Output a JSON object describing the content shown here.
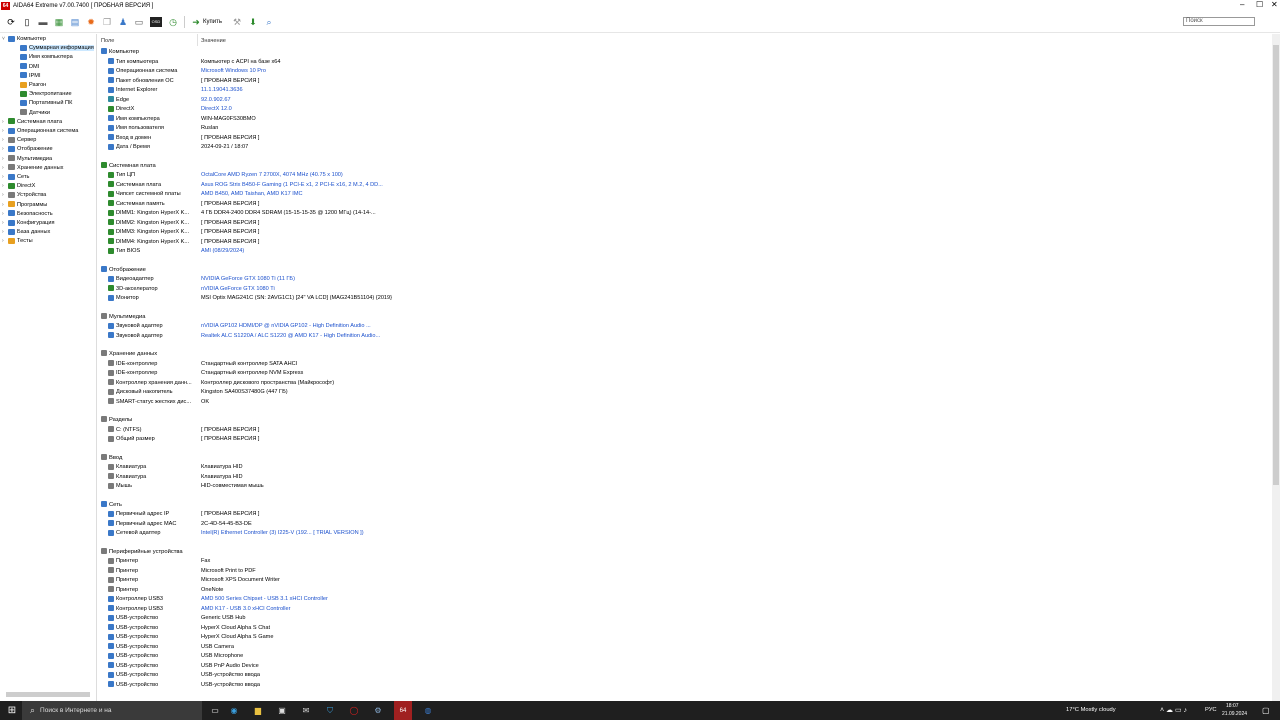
{
  "window": {
    "logo": "64",
    "title": "AIDA64 Extreme v7.00.7400  [ ПРОБНАЯ ВЕРСИЯ ]",
    "controls": {
      "min": "‒",
      "max": "☐",
      "close": "✕"
    }
  },
  "toolbar": {
    "buy_label": "Купить",
    "search_placeholder": "Поиск"
  },
  "tree": [
    {
      "label": "Компьютер",
      "exp": "˅",
      "level": 0,
      "icon": "computer-icon",
      "color": "#3a78c8"
    },
    {
      "label": "Суммарная информация",
      "exp": "",
      "level": 1,
      "icon": "summary-icon",
      "color": "#3a78c8",
      "selected": true
    },
    {
      "label": "Имя компьютера",
      "exp": "",
      "level": 1,
      "icon": "computer-name-icon",
      "color": "#3a78c8"
    },
    {
      "label": "DMI",
      "exp": "",
      "level": 1,
      "icon": "dmi-icon",
      "color": "#3a78c8"
    },
    {
      "label": "IPMI",
      "exp": "",
      "level": 1,
      "icon": "ipmi-icon",
      "color": "#3a78c8"
    },
    {
      "label": "Разгон",
      "exp": "",
      "level": 1,
      "icon": "overclock-icon",
      "color": "#e8a020"
    },
    {
      "label": "Электропитание",
      "exp": "",
      "level": 1,
      "icon": "power-icon",
      "color": "#2e8b2e"
    },
    {
      "label": "Портативный ПК",
      "exp": "",
      "level": 1,
      "icon": "laptop-icon",
      "color": "#3a78c8"
    },
    {
      "label": "Датчики",
      "exp": "",
      "level": 1,
      "icon": "sensor-icon",
      "color": "#7a7a7a"
    },
    {
      "label": "Системная плата",
      "exp": "›",
      "level": 0,
      "icon": "motherboard-icon",
      "color": "#2e8b2e"
    },
    {
      "label": "Операционная система",
      "exp": "›",
      "level": 0,
      "icon": "os-icon",
      "color": "#3a78c8"
    },
    {
      "label": "Сервер",
      "exp": "›",
      "level": 0,
      "icon": "server-icon",
      "color": "#7a7a7a"
    },
    {
      "label": "Отображение",
      "exp": "›",
      "level": 0,
      "icon": "display-icon",
      "color": "#3a78c8"
    },
    {
      "label": "Мультимедиа",
      "exp": "›",
      "level": 0,
      "icon": "multimedia-icon",
      "color": "#7a7a7a"
    },
    {
      "label": "Хранение данных",
      "exp": "›",
      "level": 0,
      "icon": "storage-icon",
      "color": "#7a7a7a"
    },
    {
      "label": "Сеть",
      "exp": "›",
      "level": 0,
      "icon": "network-icon",
      "color": "#3a78c8"
    },
    {
      "label": "DirectX",
      "exp": "›",
      "level": 0,
      "icon": "directx-icon",
      "color": "#2e8b2e"
    },
    {
      "label": "Устройства",
      "exp": "›",
      "level": 0,
      "icon": "devices-icon",
      "color": "#7a7a7a"
    },
    {
      "label": "Программы",
      "exp": "›",
      "level": 0,
      "icon": "programs-icon",
      "color": "#e8a020"
    },
    {
      "label": "Безопасность",
      "exp": "›",
      "level": 0,
      "icon": "security-icon",
      "color": "#3a78c8"
    },
    {
      "label": "Конфигурация",
      "exp": "›",
      "level": 0,
      "icon": "config-icon",
      "color": "#3a78c8"
    },
    {
      "label": "База данных",
      "exp": "›",
      "level": 0,
      "icon": "database-icon",
      "color": "#3a78c8"
    },
    {
      "label": "Тесты",
      "exp": "›",
      "level": 0,
      "icon": "tests-icon",
      "color": "#e8a020"
    }
  ],
  "columns": {
    "field": "Поле",
    "value": "Значение"
  },
  "sections": [
    {
      "title": "Компьютер",
      "icon": "computer-icon",
      "color": "#3a78c8",
      "rows": [
        {
          "field": "Тип компьютера",
          "value": "Компьютер с ACPI на базе x64",
          "link": false,
          "icon": "computer-icon",
          "color": "#3a78c8"
        },
        {
          "field": "Операционная система",
          "value": "Microsoft Windows 10 Pro",
          "link": true,
          "icon": "windows-icon",
          "color": "#3a78c8"
        },
        {
          "field": "Пакет обновления ОС",
          "value": "[ ПРОБНАЯ ВЕРСИЯ ]",
          "link": false,
          "icon": "update-icon",
          "color": "#3a78c8"
        },
        {
          "field": "Internet Explorer",
          "value": "11.1.19041.3636",
          "link": true,
          "icon": "ie-icon",
          "color": "#3a78c8"
        },
        {
          "field": "Edge",
          "value": "92.0.902.67",
          "link": true,
          "icon": "edge-icon",
          "color": "#2e8b9e"
        },
        {
          "field": "DirectX",
          "value": "DirectX 12.0",
          "link": true,
          "icon": "directx-icon",
          "color": "#2e8b2e"
        },
        {
          "field": "Имя компьютера",
          "value": "WIN-MAG0FS30BMO",
          "link": false,
          "icon": "computer-name-icon",
          "color": "#3a78c8"
        },
        {
          "field": "Имя пользователя",
          "value": "Ruslan",
          "link": false,
          "icon": "user-icon",
          "color": "#3a78c8"
        },
        {
          "field": "Вход в домен",
          "value": "[ ПРОБНАЯ ВЕРСИЯ ]",
          "link": false,
          "icon": "domain-icon",
          "color": "#3a78c8"
        },
        {
          "field": "Дата / Время",
          "value": "2024-09-21 / 18:07",
          "link": false,
          "icon": "clock-icon",
          "color": "#3a78c8"
        }
      ]
    },
    {
      "title": "Системная плата",
      "icon": "motherboard-icon",
      "color": "#2e8b2e",
      "rows": [
        {
          "field": "Тип ЦП",
          "value": "OctalCore AMD Ryzen 7 2700X, 4074 MHz (40.75 x 100)",
          "link": true,
          "icon": "cpu-icon",
          "color": "#2e8b2e"
        },
        {
          "field": "Системная плата",
          "value": "Asus ROG Strix B450-F Gaming  (1 PCI-E x1, 2 PCI-E x16, 2 M.2, 4 DD...",
          "link": true,
          "icon": "motherboard-icon",
          "color": "#2e8b2e"
        },
        {
          "field": "Чипсет системной платы",
          "value": "AMD B450, AMD Taishan, AMD K17 IMC",
          "link": true,
          "icon": "chipset-icon",
          "color": "#2e8b2e"
        },
        {
          "field": "Системная память",
          "value": "[ ПРОБНАЯ ВЕРСИЯ ]",
          "link": false,
          "icon": "memory-icon",
          "color": "#2e8b2e"
        },
        {
          "field": "DIMM1: Kingston HyperX K...",
          "value": "4 ГБ DDR4-2400 DDR4 SDRAM  (15-15-15-35 @ 1200 МГц)  (14-14-...",
          "link": false,
          "icon": "memory-icon",
          "color": "#2e8b2e"
        },
        {
          "field": "DIMM2: Kingston HyperX K...",
          "value": "[ ПРОБНАЯ ВЕРСИЯ ]",
          "link": false,
          "icon": "memory-icon",
          "color": "#2e8b2e"
        },
        {
          "field": "DIMM3: Kingston HyperX K...",
          "value": "[ ПРОБНАЯ ВЕРСИЯ ]",
          "link": false,
          "icon": "memory-icon",
          "color": "#2e8b2e"
        },
        {
          "field": "DIMM4: Kingston HyperX K...",
          "value": "[ ПРОБНАЯ ВЕРСИЯ ]",
          "link": false,
          "icon": "memory-icon",
          "color": "#2e8b2e"
        },
        {
          "field": "Тип BIOS",
          "value": "AMI (08/29/2024)",
          "link": true,
          "icon": "bios-icon",
          "color": "#2e8b2e"
        }
      ]
    },
    {
      "title": "Отображение",
      "icon": "display-icon",
      "color": "#3a78c8",
      "rows": [
        {
          "field": "Видеоадаптер",
          "value": "NVIDIA GeForce GTX 1080 Ti  (11 ГБ)",
          "link": true,
          "icon": "gpu-icon",
          "color": "#3a78c8"
        },
        {
          "field": "3D-акселератор",
          "value": "nVIDIA GeForce GTX 1080 Ti",
          "link": true,
          "icon": "accelerator-icon",
          "color": "#2e8b2e"
        },
        {
          "field": "Монитор",
          "value": "MSI Optix MAG241C (SN: 2AVG1C1) [24\" VA LCD] (MAG241B51104) {2019}",
          "link": false,
          "icon": "monitor-icon",
          "color": "#3a78c8"
        }
      ]
    },
    {
      "title": "Мультимедиа",
      "icon": "multimedia-icon",
      "color": "#7a7a7a",
      "rows": [
        {
          "field": "Звуковой адаптер",
          "value": "nVIDIA GP102 HDMI/DP @ nVIDIA GP102 - High Definition Audio ...",
          "link": true,
          "icon": "audio-icon",
          "color": "#3a78c8"
        },
        {
          "field": "Звуковой адаптер",
          "value": "Realtek ALC S1220A / ALC S1220 @ AMD K17 - High Definition Audio...",
          "link": true,
          "icon": "audio-icon",
          "color": "#3a78c8"
        }
      ]
    },
    {
      "title": "Хранение данных",
      "icon": "storage-icon",
      "color": "#7a7a7a",
      "rows": [
        {
          "field": "IDE-контроллер",
          "value": "Стандартный контроллер SATA AHCI",
          "link": false,
          "icon": "controller-icon",
          "color": "#7a7a7a"
        },
        {
          "field": "IDE-контроллер",
          "value": "Стандартный контроллер NVM Express",
          "link": false,
          "icon": "controller-icon",
          "color": "#7a7a7a"
        },
        {
          "field": "Контроллер хранения данн...",
          "value": "Контроллер дискового пространства (Майкрософт)",
          "link": false,
          "icon": "controller-icon",
          "color": "#7a7a7a"
        },
        {
          "field": "Дисковый накопитель",
          "value": "Kingston SA400S37480G  (447 ГБ)",
          "link": false,
          "icon": "disk-icon",
          "color": "#7a7a7a"
        },
        {
          "field": "SMART-статус жестких дис...",
          "value": "OK",
          "link": false,
          "icon": "smart-icon",
          "color": "#7a7a7a"
        }
      ]
    },
    {
      "title": "Разделы",
      "icon": "partition-icon",
      "color": "#7a7a7a",
      "rows": [
        {
          "field": "C: (NTFS)",
          "value": "[ ПРОБНАЯ ВЕРСИЯ ]",
          "link": false,
          "icon": "partition-icon",
          "color": "#7a7a7a"
        },
        {
          "field": "Общий размер",
          "value": "[ ПРОБНАЯ ВЕРСИЯ ]",
          "link": false,
          "icon": "partition-icon",
          "color": "#7a7a7a"
        }
      ]
    },
    {
      "title": "Ввод",
      "icon": "input-icon",
      "color": "#7a7a7a",
      "rows": [
        {
          "field": "Клавиатура",
          "value": "Клавиатура HID",
          "link": false,
          "icon": "keyboard-icon",
          "color": "#7a7a7a"
        },
        {
          "field": "Клавиатура",
          "value": "Клавиатура HID",
          "link": false,
          "icon": "keyboard-icon",
          "color": "#7a7a7a"
        },
        {
          "field": "Мышь",
          "value": "HID-совместимая мышь",
          "link": false,
          "icon": "mouse-icon",
          "color": "#7a7a7a"
        }
      ]
    },
    {
      "title": "Сеть",
      "icon": "network-icon",
      "color": "#3a78c8",
      "rows": [
        {
          "field": "Первичный адрес IP",
          "value": "[ ПРОБНАЯ ВЕРСИЯ ]",
          "link": false,
          "icon": "network-icon",
          "color": "#3a78c8"
        },
        {
          "field": "Первичный адрес MAC",
          "value": "2C-4D-54-45-B3-DE",
          "link": false,
          "icon": "network-icon",
          "color": "#3a78c8"
        },
        {
          "field": "Сетевой адаптер",
          "value": "Intel(R) Ethernet Controller (3) I225-V  (192... [ TRIAL VERSION ])",
          "link": true,
          "icon": "network-adapter-icon",
          "color": "#3a78c8"
        }
      ]
    },
    {
      "title": "Периферийные устройства",
      "icon": "peripherals-icon",
      "color": "#7a7a7a",
      "rows": [
        {
          "field": "Принтер",
          "value": "Fax",
          "link": false,
          "icon": "printer-icon",
          "color": "#7a7a7a"
        },
        {
          "field": "Принтер",
          "value": "Microsoft Print to PDF",
          "link": false,
          "icon": "printer-icon",
          "color": "#7a7a7a"
        },
        {
          "field": "Принтер",
          "value": "Microsoft XPS Document Writer",
          "link": false,
          "icon": "printer-icon",
          "color": "#7a7a7a"
        },
        {
          "field": "Принтер",
          "value": "OneNote",
          "link": false,
          "icon": "printer-icon",
          "color": "#7a7a7a"
        },
        {
          "field": "Контроллер USB3",
          "value": "AMD 500 Series Chipset - USB 3.1 xHCI Controller",
          "link": true,
          "icon": "usb-icon",
          "color": "#3a78c8"
        },
        {
          "field": "Контроллер USB3",
          "value": "AMD K17 - USB 3.0 xHCI Controller",
          "link": true,
          "icon": "usb-icon",
          "color": "#3a78c8"
        },
        {
          "field": "USB-устройство",
          "value": "Generic USB Hub",
          "link": false,
          "icon": "usb-icon",
          "color": "#3a78c8"
        },
        {
          "field": "USB-устройство",
          "value": "HyperX Cloud Alpha S Chat",
          "link": false,
          "icon": "usb-icon",
          "color": "#3a78c8"
        },
        {
          "field": "USB-устройство",
          "value": "HyperX Cloud Alpha S Game",
          "link": false,
          "icon": "usb-icon",
          "color": "#3a78c8"
        },
        {
          "field": "USB-устройство",
          "value": "USB Camera",
          "link": false,
          "icon": "usb-icon",
          "color": "#3a78c8"
        },
        {
          "field": "USB-устройство",
          "value": "USB Microphone",
          "link": false,
          "icon": "usb-icon",
          "color": "#3a78c8"
        },
        {
          "field": "USB-устройство",
          "value": "USB PnP Audio Device",
          "link": false,
          "icon": "usb-icon",
          "color": "#3a78c8"
        },
        {
          "field": "USB-устройство",
          "value": "USB-устройство ввода",
          "link": false,
          "icon": "usb-icon",
          "color": "#3a78c8"
        },
        {
          "field": "USB-устройство",
          "value": "USB-устройство ввода",
          "link": false,
          "icon": "usb-icon",
          "color": "#3a78c8"
        }
      ]
    }
  ],
  "taskbar": {
    "start": "⊞",
    "search_icon": "⌕",
    "search_text": "Поиск в Интернете и на",
    "weather": "17°C  Mostly cloudy",
    "lang": "РУС",
    "time": "18:07",
    "date": "21.09.2024"
  }
}
